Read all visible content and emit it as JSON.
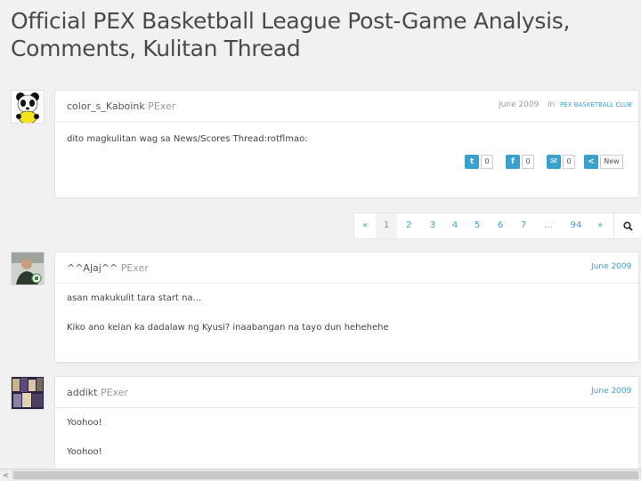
{
  "thread": {
    "title": "Official PEX Basketball League Post-Game Analysis, Comments, Kulitan Thread"
  },
  "posts": [
    {
      "author": "color_s_Kaboink",
      "role": "PExer",
      "date": "June 2009",
      "in_label": "in",
      "category": "PEX BASKETBALL CLUB",
      "lines": [
        "dito magkulitan wag sa News/Scores Thread:rotflmao:"
      ],
      "shares": [
        {
          "icon": "twitter-icon",
          "glyph": "t",
          "count": "0"
        },
        {
          "icon": "facebook-icon",
          "glyph": "f",
          "count": "0"
        },
        {
          "icon": "email-icon",
          "glyph": "✉",
          "count": "0"
        },
        {
          "icon": "share-icon",
          "glyph": "<",
          "count": "New"
        }
      ]
    },
    {
      "author": "^^Ajaj^^",
      "role": "PExer",
      "date": "June 2009",
      "lines": [
        "asan makukulit tara start na...",
        "Kiko ano kelan ka dadalaw ng Kyusi? inaabangan na tayo dun hehehehe"
      ]
    },
    {
      "author": "addikt",
      "role": "PExer",
      "date": "June 2009",
      "lines": [
        "Yoohoo!",
        "Yoohoo!"
      ]
    }
  ],
  "pagination": {
    "items": [
      "«",
      "1",
      "2",
      "3",
      "4",
      "5",
      "6",
      "7",
      "…",
      "94",
      "»"
    ],
    "current": "1"
  },
  "colors": {
    "accent": "#3d9fd0",
    "share_icon_bg": "#3aa0cc",
    "page_bg": "#f1f1f1"
  }
}
